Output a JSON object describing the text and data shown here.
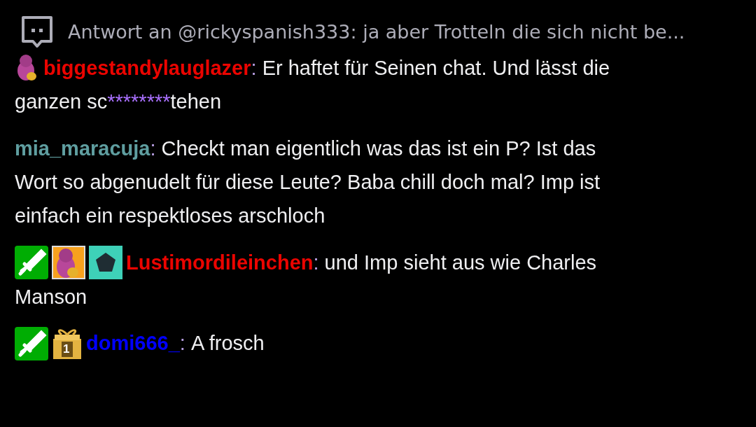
{
  "reply": {
    "text": "Antwort an @rickyspanish333: ja aber Trotteln die sich nicht be..."
  },
  "messages": [
    {
      "badges": [
        {
          "kind": "creature"
        }
      ],
      "username": "biggestandylauglazer",
      "color": "#eb0400",
      "separator": ":",
      "lines": [
        [
          {
            "kind": "text",
            "text": " Er haftet für Seinen chat. Und lässt die"
          }
        ],
        [
          {
            "kind": "text",
            "text": "ganzen sc"
          },
          {
            "kind": "censored",
            "text": "********"
          },
          {
            "kind": "text",
            "text": "tehen"
          }
        ]
      ]
    },
    {
      "username": "mia_maracuja",
      "color": "#5f9ea0",
      "separator": ":",
      "lines": [
        [
          {
            "kind": "text",
            "text": "Checkt man eigentlich was das ist ein P? Ist das"
          }
        ],
        [
          {
            "kind": "text",
            "text": "Wort so abgenudelt für diese Leute? Baba chill doch mal? Imp ist"
          }
        ],
        [
          {
            "kind": "text",
            "text": "einfach ein respektloses arschloch"
          }
        ]
      ]
    },
    {
      "badges": [
        {
          "kind": "sword"
        },
        {
          "kind": "creature-tile"
        },
        {
          "kind": "pentagon"
        }
      ],
      "username": "Lustimordileinchen",
      "color": "#eb0400",
      "separator": ":",
      "lines": [
        [
          {
            "kind": "text",
            "text": "und Imp sieht aus wie Charles"
          }
        ],
        [
          {
            "kind": "text",
            "text": "Manson"
          }
        ]
      ]
    },
    {
      "badges": [
        {
          "kind": "sword"
        },
        {
          "kind": "gift",
          "label": "1"
        }
      ],
      "username": "domi666_",
      "color": "#0000ff",
      "separator": ":",
      "lines": [
        [
          {
            "kind": "text",
            "text": "A frosch"
          }
        ]
      ]
    }
  ]
}
